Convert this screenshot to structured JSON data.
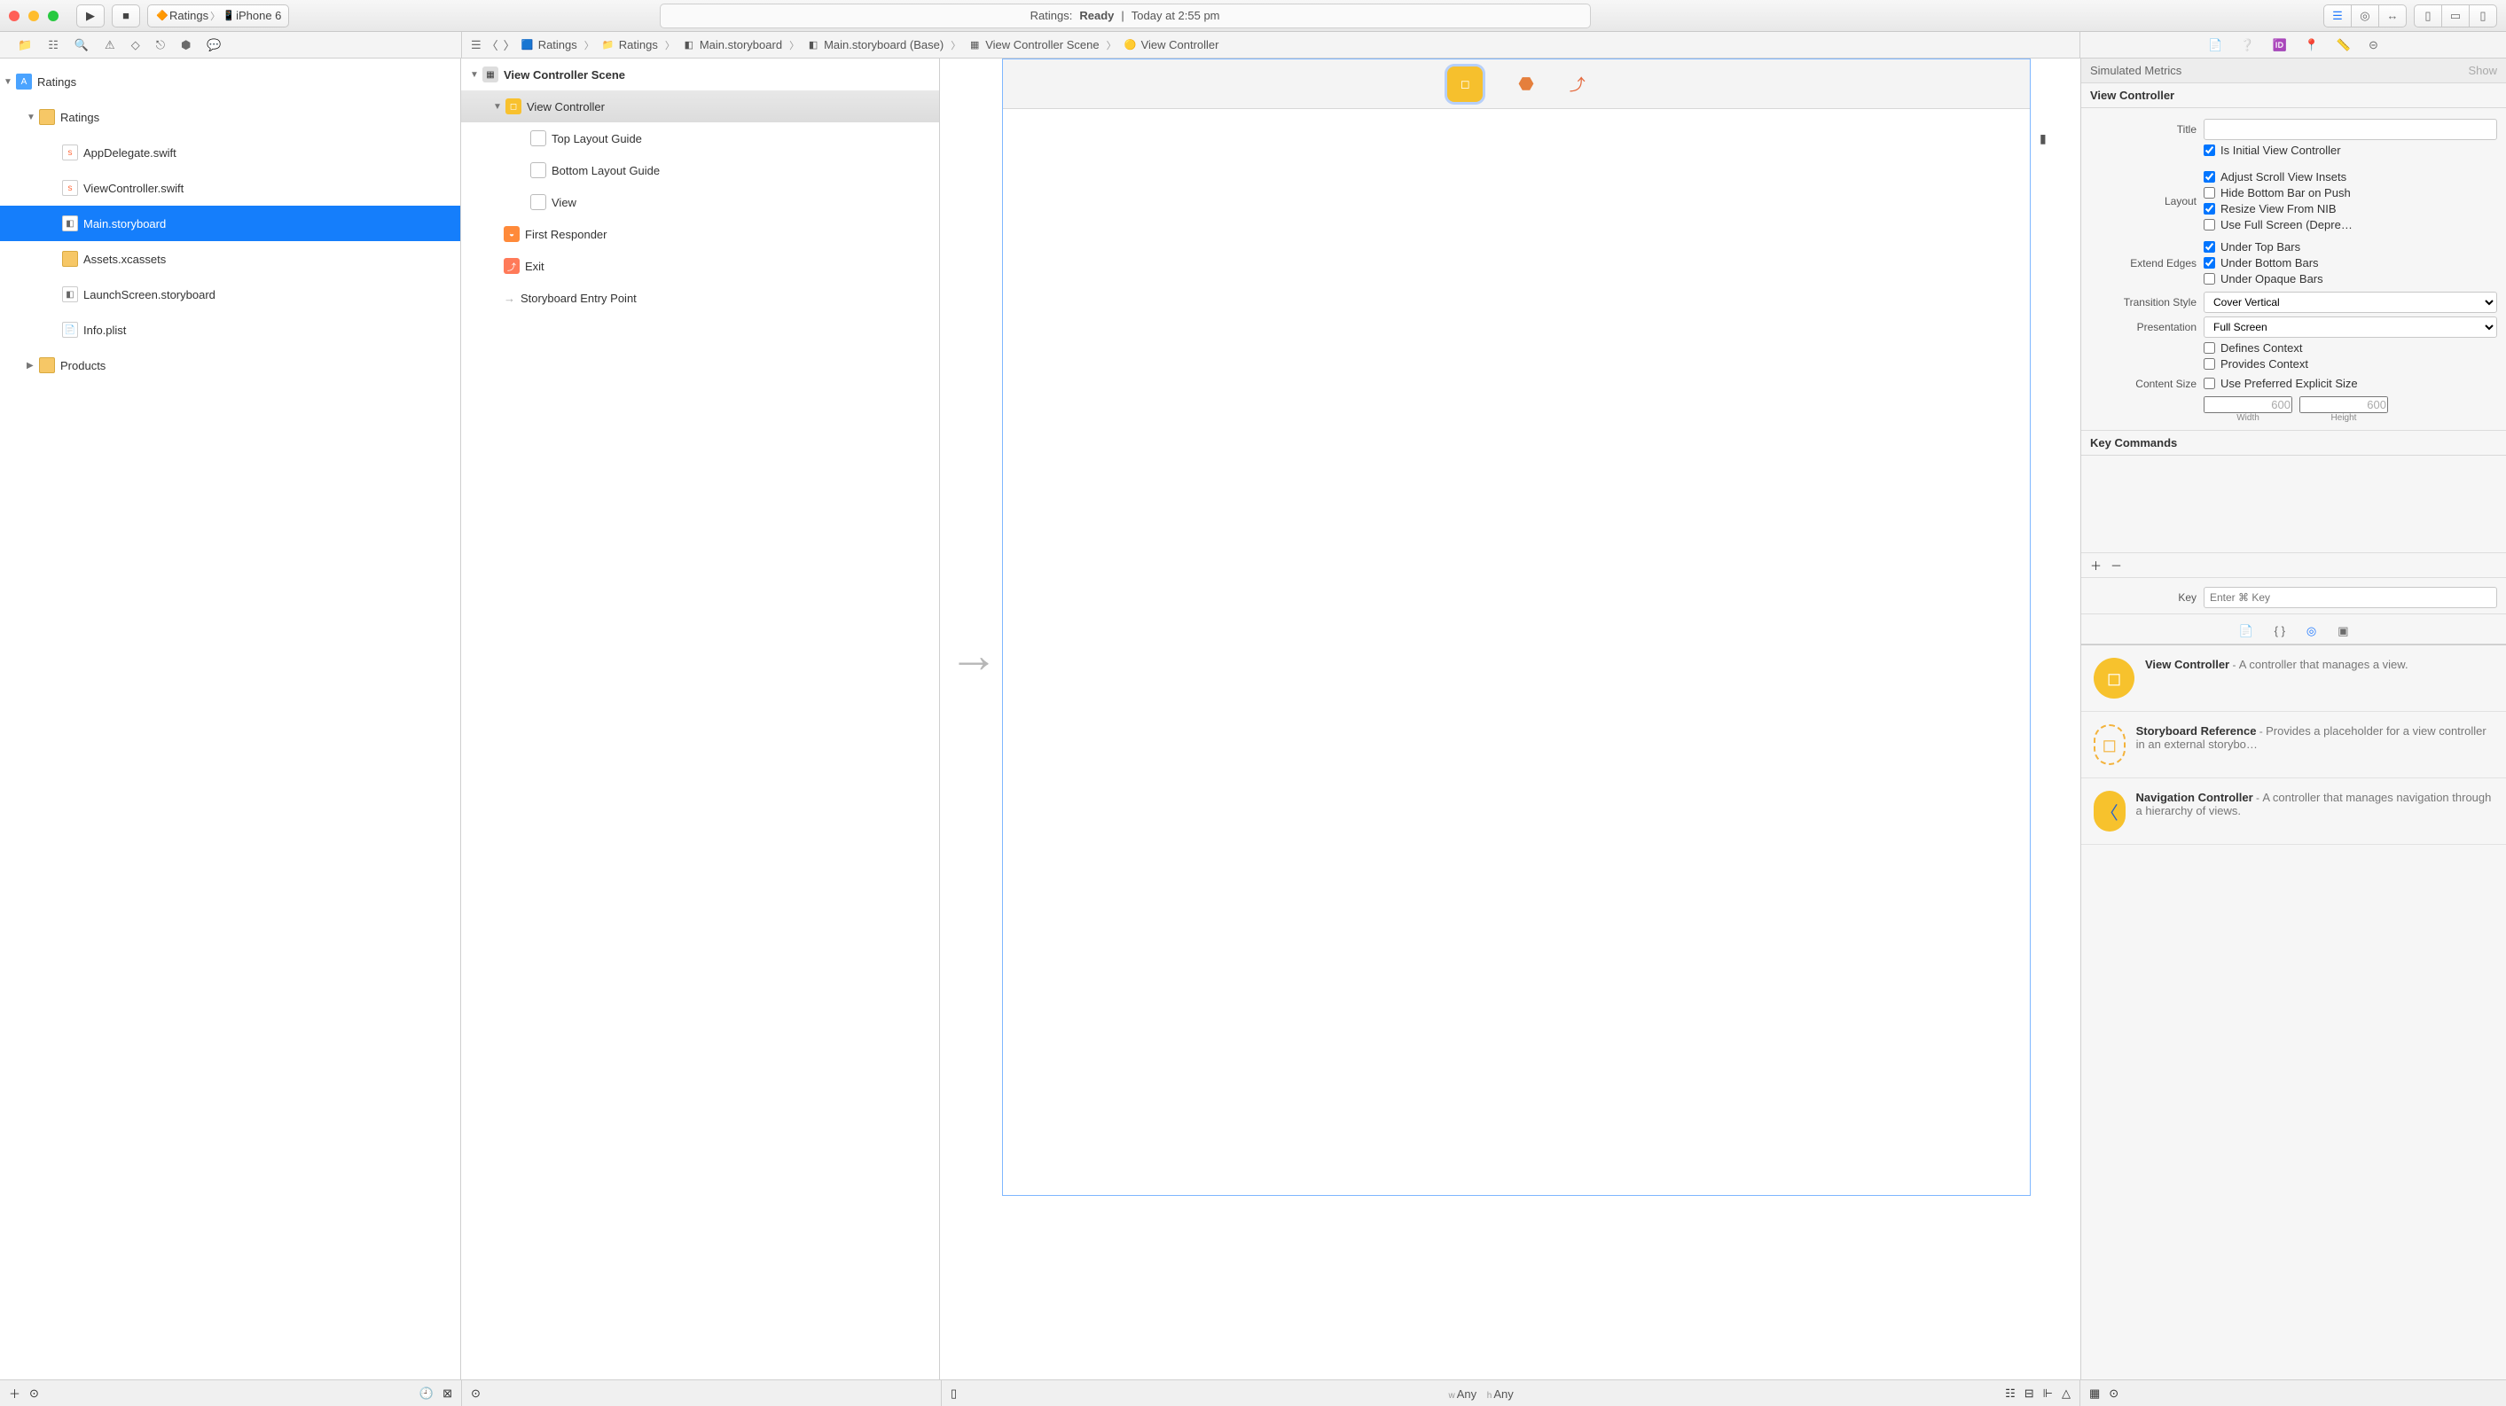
{
  "toolbar": {
    "scheme": "Ratings",
    "device": "iPhone 6",
    "status_project": "Ratings:",
    "status_state": "Ready",
    "status_time": "Today at 2:55 pm"
  },
  "navigator": {
    "root": "Ratings",
    "group": "Ratings",
    "files": [
      {
        "name": "AppDelegate.swift",
        "kind": "swift"
      },
      {
        "name": "ViewController.swift",
        "kind": "swift"
      },
      {
        "name": "Main.storyboard",
        "kind": "sb",
        "selected": true
      },
      {
        "name": "Assets.xcassets",
        "kind": "fold"
      },
      {
        "name": "LaunchScreen.storyboard",
        "kind": "sb"
      },
      {
        "name": "Info.plist",
        "kind": "plist"
      }
    ],
    "products": "Products"
  },
  "jumpbar": {
    "items": [
      "Ratings",
      "Ratings",
      "Main.storyboard",
      "Main.storyboard (Base)",
      "View Controller Scene",
      "View Controller"
    ]
  },
  "outline": {
    "scene": "View Controller Scene",
    "vc": "View Controller",
    "children": [
      "Top Layout Guide",
      "Bottom Layout Guide",
      "View"
    ],
    "first_responder": "First Responder",
    "exit": "Exit",
    "entry": "Storyboard Entry Point"
  },
  "inspector": {
    "simulated_header": "Simulated Metrics",
    "show": "Show",
    "vc_header": "View Controller",
    "title_label": "Title",
    "title_value": "",
    "is_initial": "Is Initial View Controller",
    "layout_label": "Layout",
    "adjust_scroll": "Adjust Scroll View Insets",
    "hide_bottom": "Hide Bottom Bar on Push",
    "resize_nib": "Resize View From NIB",
    "use_full_screen": "Use Full Screen (Depre…",
    "extend_label": "Extend Edges",
    "under_top": "Under Top Bars",
    "under_bottom": "Under Bottom Bars",
    "under_opaque": "Under Opaque Bars",
    "transition_label": "Transition Style",
    "transition_value": "Cover Vertical",
    "presentation_label": "Presentation",
    "presentation_value": "Full Screen",
    "defines_context": "Defines Context",
    "provides_context": "Provides Context",
    "content_size_label": "Content Size",
    "use_preferred": "Use Preferred Explicit Size",
    "width_val": "600",
    "height_val": "600",
    "width_cap": "Width",
    "height_cap": "Height",
    "key_commands": "Key Commands",
    "key_label": "Key",
    "key_placeholder": "Enter ⌘ Key"
  },
  "library": {
    "items": [
      {
        "title": "View Controller",
        "desc": "A controller that manages a view.",
        "kind": "vc"
      },
      {
        "title": "Storyboard Reference",
        "desc": "Provides a placeholder for a view controller in an external storybo…",
        "kind": "ref"
      },
      {
        "title": "Navigation Controller",
        "desc": "A controller that manages navigation through a hierarchy of views.",
        "kind": "nav"
      }
    ]
  },
  "sizeclass": {
    "w": "Any",
    "h": "Any",
    "wlabel": "w",
    "hlabel": "h"
  }
}
